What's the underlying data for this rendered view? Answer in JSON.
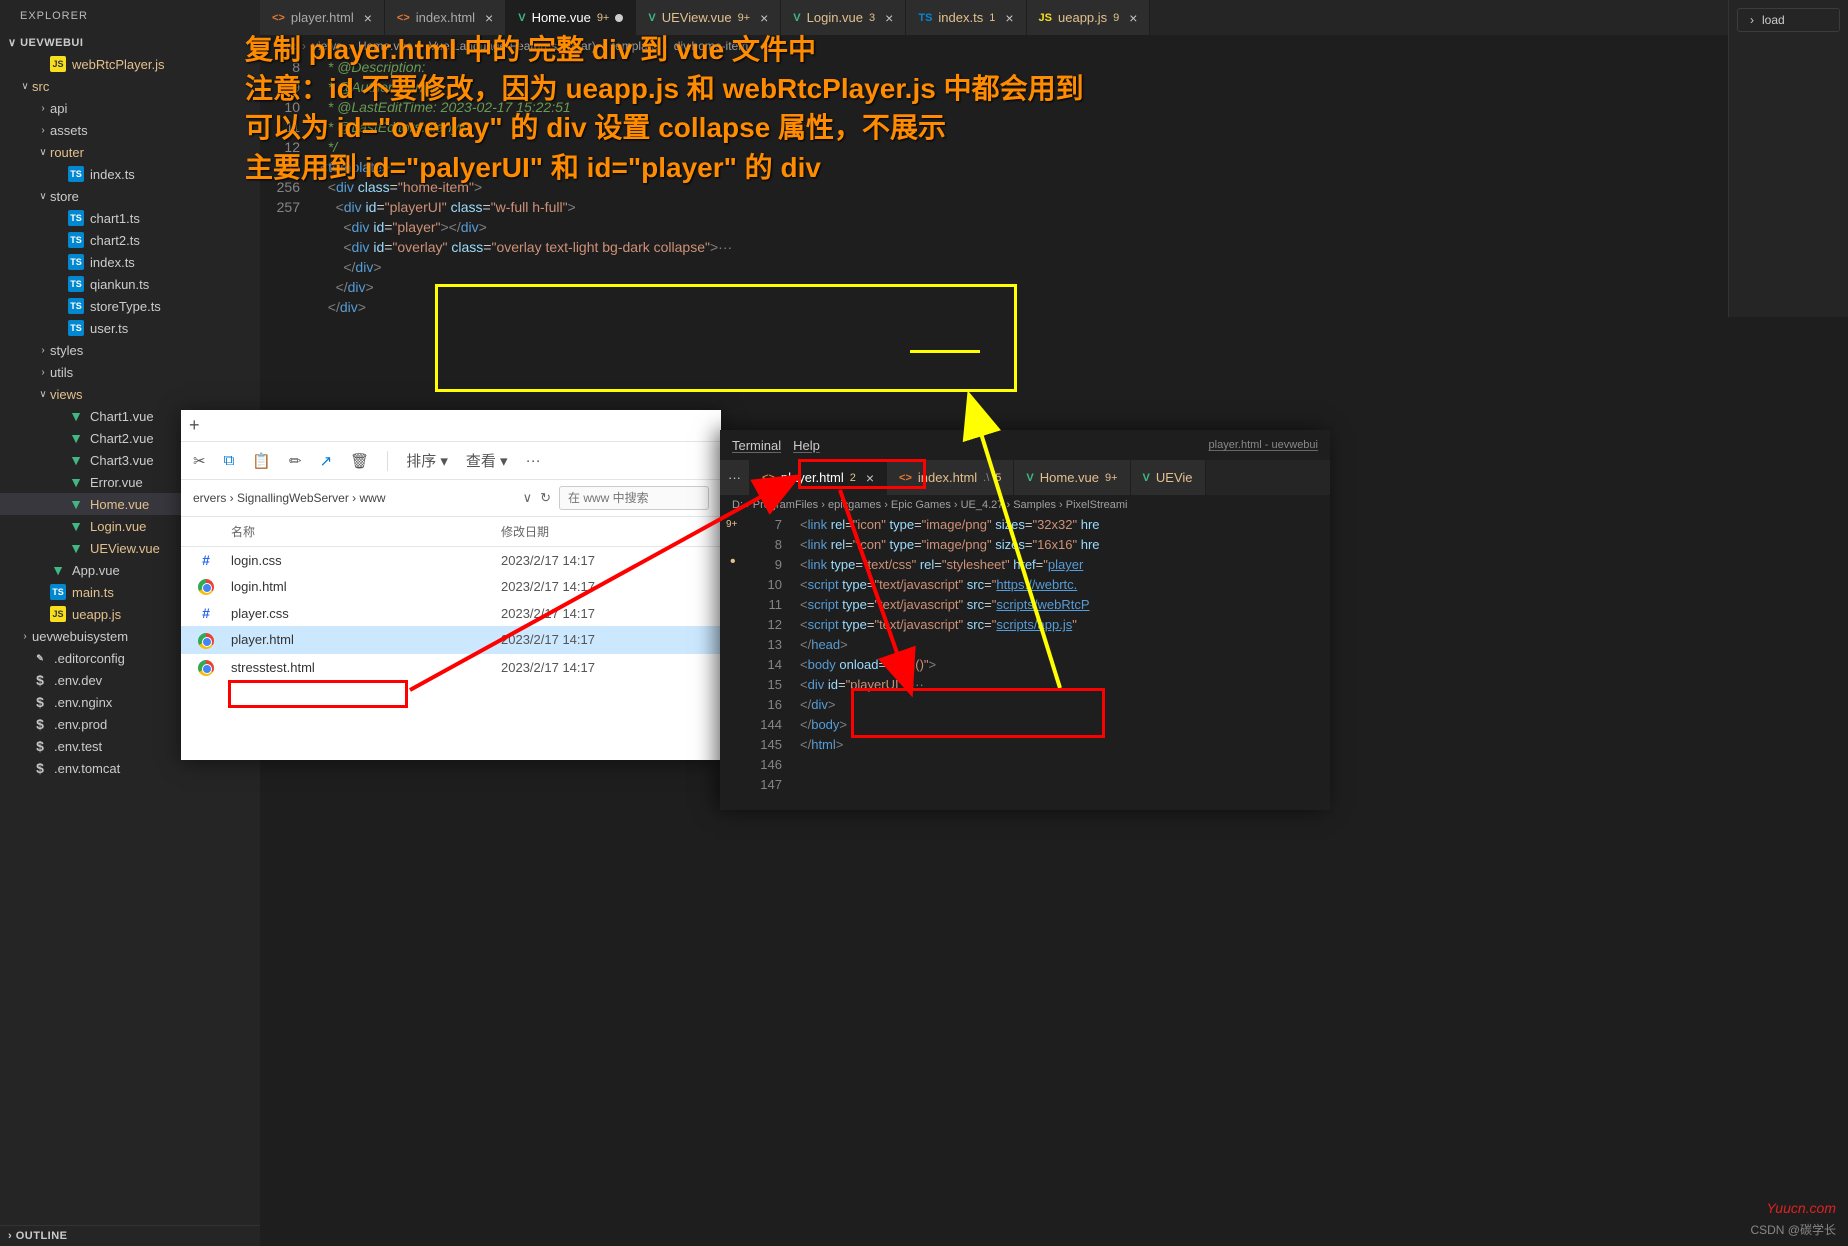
{
  "explorer": {
    "title": "EXPLORER",
    "root": "UEVWEBUI",
    "outline_section": "OUTLINE",
    "tree": [
      {
        "label": "webRtcPlayer.js",
        "indent": 36,
        "icon": "js",
        "cls": "lbl-y"
      },
      {
        "label": "src",
        "indent": 18,
        "chev": "∨",
        "cls": "lbl-y"
      },
      {
        "label": "api",
        "indent": 36,
        "chev": "›"
      },
      {
        "label": "assets",
        "indent": 36,
        "chev": "›"
      },
      {
        "label": "router",
        "indent": 36,
        "chev": "∨",
        "cls": "lbl-y"
      },
      {
        "label": "index.ts",
        "indent": 54,
        "icon": "ts"
      },
      {
        "label": "store",
        "indent": 36,
        "chev": "∨"
      },
      {
        "label": "chart1.ts",
        "indent": 54,
        "icon": "ts"
      },
      {
        "label": "chart2.ts",
        "indent": 54,
        "icon": "ts"
      },
      {
        "label": "index.ts",
        "indent": 54,
        "icon": "ts"
      },
      {
        "label": "qiankun.ts",
        "indent": 54,
        "icon": "ts"
      },
      {
        "label": "storeType.ts",
        "indent": 54,
        "icon": "ts"
      },
      {
        "label": "user.ts",
        "indent": 54,
        "icon": "ts"
      },
      {
        "label": "styles",
        "indent": 36,
        "chev": "›"
      },
      {
        "label": "utils",
        "indent": 36,
        "chev": "›"
      },
      {
        "label": "views",
        "indent": 36,
        "chev": "∨",
        "cls": "lbl-y"
      },
      {
        "label": "Chart1.vue",
        "indent": 54,
        "icon": "vue"
      },
      {
        "label": "Chart2.vue",
        "indent": 54,
        "icon": "vue"
      },
      {
        "label": "Chart3.vue",
        "indent": 54,
        "icon": "vue"
      },
      {
        "label": "Error.vue",
        "indent": 54,
        "icon": "vue"
      },
      {
        "label": "Home.vue",
        "indent": 54,
        "icon": "vue",
        "cls": "lbl-y",
        "active": true,
        "tag": "9+, M"
      },
      {
        "label": "Login.vue",
        "indent": 54,
        "icon": "vue",
        "cls": "lbl-y"
      },
      {
        "label": "UEView.vue",
        "indent": 54,
        "icon": "vue",
        "cls": "lbl-y"
      },
      {
        "label": "App.vue",
        "indent": 36,
        "icon": "vue"
      },
      {
        "label": "main.ts",
        "indent": 36,
        "icon": "ts",
        "cls": "lbl-y"
      },
      {
        "label": "ueapp.js",
        "indent": 36,
        "icon": "js",
        "cls": "lbl-y"
      },
      {
        "label": "uevwebuisystem",
        "indent": 18,
        "chev": "›"
      },
      {
        "label": ".editorconfig",
        "indent": 18,
        "icon": "file"
      },
      {
        "label": ".env.dev",
        "indent": 18,
        "icon": "dollar"
      },
      {
        "label": ".env.nginx",
        "indent": 18,
        "icon": "dollar"
      },
      {
        "label": ".env.prod",
        "indent": 18,
        "icon": "dollar"
      },
      {
        "label": ".env.test",
        "indent": 18,
        "icon": "dollar"
      },
      {
        "label": ".env.tomcat",
        "indent": 18,
        "icon": "dollar"
      }
    ]
  },
  "tabs": [
    {
      "label": "player.html",
      "icon": "<>",
      "iconColor": "#e37933"
    },
    {
      "label": "index.html",
      "icon": "<>",
      "iconColor": "#e37933"
    },
    {
      "label": "Home.vue",
      "icon": "V",
      "iconColor": "#41b883",
      "badge": "9+",
      "badgeColor": "#e2c08d",
      "active": true
    },
    {
      "label": "UEView.vue",
      "icon": "V",
      "iconColor": "#41b883",
      "badge": "9+",
      "badgeColor": "#e2c08d"
    },
    {
      "label": "Login.vue",
      "icon": "V",
      "iconColor": "#41b883",
      "badge": "3",
      "badgeColor": "#e2c08d"
    },
    {
      "label": "index.ts",
      "icon": "TS",
      "iconColor": "#0288d1",
      "badge": "1",
      "badgeColor": "#e2c08d"
    },
    {
      "label": "ueapp.js",
      "icon": "JS",
      "iconColor": "#f7df1e",
      "badge": "9",
      "badgeColor": "#e2c08d"
    }
  ],
  "breadcrumb": [
    "src",
    "views",
    "Home.vue",
    "Vue Language Features (Volar)",
    "template",
    "div.home-item"
  ],
  "right_panel_item": "load",
  "annotation": {
    "line1": "复制 player.html 中的 完整 div 到 vue 文件中",
    "line2": "注意：id 不要修改，因为 ueapp.js 和 webRtcPlayer.js 中都会用到",
    "line3": "可以为 id=\"overlay\" 的 div 设置 collapse 属性，不展示",
    "line4": "主要用到 id=\"palyerUI\" 和 id=\"player\" 的 div"
  },
  "code_main": {
    "line_numbers": [
      "7",
      "8",
      "9",
      "10",
      "11",
      "12",
      "255",
      "256",
      "257"
    ],
    "body": [
      {
        "raw": "  <span class='comment'>* @Description:</span>"
      },
      {
        "raw": "  <span class='comment'>* @Author: tianyw</span>"
      },
      {
        "raw": "  <span class='comment'>* @LastEditTime: 2023-02-17 15:22:51</span>"
      },
      {
        "raw": "  <span class='comment'>* @LastEditors: tianyw</span>"
      },
      {
        "raw": "  <span class='comment'>*/</span>"
      },
      {
        "raw": "<span class='tag'>&lt;</span><span class='tagname'>template</span><span class='tag'>&gt;</span>"
      },
      {
        "raw": "  <span class='tag'>&lt;</span><span class='tagname'>div</span> <span class='attr'>class</span>=<span class='val'>\"home-item\"</span><span class='tag'>&gt;</span>"
      },
      {
        "raw": "    <span class='tag'>&lt;</span><span class='tagname'>div</span> <span class='attr'>id</span>=<span class='val'>\"playerUI\"</span> <span class='attr'>class</span>=<span class='val'>\"w-full h-full\"</span><span class='tag'>&gt;</span>"
      },
      {
        "raw": "      <span class='tag'>&lt;</span><span class='tagname'>div</span> <span class='attr'>id</span>=<span class='val'>\"player\"</span><span class='tag'>&gt;&lt;/</span><span class='tagname'>div</span><span class='tag'>&gt;</span>"
      },
      {
        "raw": "      <span class='tag'>&lt;</span><span class='tagname'>div</span> <span class='attr'>id</span>=<span class='val'>\"overlay\"</span> <span class='attr'>class</span>=<span class='val'>\"overlay text-light bg-dark collapse\"</span><span class='tag'>&gt;</span><span style='color:#808080'>&middot;&middot;&middot;</span>"
      },
      {
        "raw": "      <span class='tag'>&lt;/</span><span class='tagname'>div</span><span class='tag'>&gt;</span>"
      },
      {
        "raw": "    <span class='tag'>&lt;/</span><span class='tagname'>div</span><span class='tag'>&gt;</span>"
      },
      {
        "raw": "  <span class='tag'>&lt;/</span><span class='tagname'>div</span><span class='tag'>&gt;</span>"
      }
    ]
  },
  "file_explorer": {
    "newtab": "+",
    "toolbar": {
      "sort": "排序 ▾",
      "view": "查看 ▾"
    },
    "path": "ervers › SignallingWebServer › www",
    "search_placeholder": "在 www 中搜索",
    "hdr_name": "名称",
    "hdr_date": "修改日期",
    "files": [
      {
        "name": "login.css",
        "date": "2023/2/17 14:17",
        "type": "css"
      },
      {
        "name": "login.html",
        "date": "2023/2/17 14:17",
        "type": "chrome"
      },
      {
        "name": "player.css",
        "date": "2023/2/17 14:17",
        "type": "css"
      },
      {
        "name": "player.html",
        "date": "2023/2/17 14:17",
        "type": "chrome",
        "selected": true
      },
      {
        "name": "stresstest.html",
        "date": "2023/2/17 14:17",
        "type": "chrome"
      }
    ]
  },
  "editor2": {
    "menu": {
      "terminal": "Terminal",
      "help": "Help"
    },
    "title_right": "player.html - uevwebui",
    "tabs": [
      {
        "label": "player.html",
        "icon": "<>",
        "iconColor": "#e37933",
        "badge": "2",
        "active": true,
        "close": "×"
      },
      {
        "label": "index.html",
        "icon": "<>",
        "iconColor": "#e37933",
        "extra": ".\\",
        "badge": "5"
      },
      {
        "label": "Home.vue",
        "icon": "V",
        "iconColor": "#41b883",
        "badge": "9+"
      },
      {
        "label": "UEVie",
        "icon": "V",
        "iconColor": "#41b883"
      }
    ],
    "breadcrumb": "D: › ProgramFiles › epicgames › Epic Games › UE_4.27 › Samples › PixelStreami",
    "line_numbers": [
      "7",
      "8",
      "9",
      "10",
      "11",
      "12",
      "13",
      "14",
      "15",
      "16",
      "144",
      "145",
      "146",
      "147"
    ],
    "gutter_badges": {
      "0": "9+",
      "2": "•"
    },
    "body": [
      {
        "raw": "    <span class='tag'>&lt;</span><span class='tagname'>link</span> <span class='attr'>rel</span>=<span class='val'>\"icon\"</span> <span class='attr'>type</span>=<span class='val'>\"image/png\"</span> <span class='attr'>sizes</span>=<span class='val'>\"32x32\"</span> <span class='attr'>hre</span>"
      },
      {
        "raw": "    <span class='tag'>&lt;</span><span class='tagname'>link</span> <span class='attr'>rel</span>=<span class='val'>\"icon\"</span> <span class='attr'>type</span>=<span class='val'>\"image/png\"</span> <span class='attr'>sizes</span>=<span class='val'>\"16x16\"</span> <span class='attr'>hre</span>"
      },
      {
        "raw": "    <span class='tag'>&lt;</span><span class='tagname'>link</span> <span class='attr'>type</span>=<span class='val'>\"text/css\"</span> <span class='attr'>rel</span>=<span class='val'>\"stylesheet\"</span> <span class='attr'>href</span>=<span class='val'>\"<span class='url-link'>player</span></span>"
      },
      {
        "raw": "    <span class='tag'>&lt;</span><span class='tagname'>script</span> <span class='attr'>type</span>=<span class='val'>\"text/javascript\"</span> <span class='attr'>src</span>=<span class='val'>\"<span class='url-link'>https://webrtc.</span></span>"
      },
      {
        "raw": "    <span class='tag'>&lt;</span><span class='tagname'>script</span> <span class='attr'>type</span>=<span class='val'>\"text/javascript\"</span> <span class='attr'>src</span>=<span class='val'>\"<span class='url-link'>scripts/webRtcP</span></span>"
      },
      {
        "raw": "    <span class='tag'>&lt;</span><span class='tagname'>script</span> <span class='attr'>type</span>=<span class='val'>\"text/javascript\"</span> <span class='attr'>src</span>=<span class='val'>\"<span class='url-link'>scripts/app.js</span>\"</span>"
      },
      {
        "raw": "<span class='tag'>&lt;/</span><span class='tagname'>head</span><span class='tag'>&gt;</span>"
      },
      {
        "raw": ""
      },
      {
        "raw": "<span class='tag'>&lt;</span><span class='tagname'>body</span> <span class='attr'>onload</span>=<span class='val'>\"load()\"</span><span class='tag'>&gt;</span>"
      },
      {
        "raw": "    <span class='tag'>&lt;</span><span class='tagname'>div</span> <span class='attr'>id</span>=<span class='val'>\"playerUI\"</span><span class='tag'>&gt;</span><span style='color:#808080'>&middot;&middot;&middot;</span>"
      },
      {
        "raw": "    <span class='tag'>&lt;/</span><span class='tagname'>div</span><span class='tag'>&gt;</span>"
      },
      {
        "raw": "<span class='tag'>&lt;/</span><span class='tagname'>body</span><span class='tag'>&gt;</span>"
      },
      {
        "raw": "<span class='tag'>&lt;/</span><span class='tagname'>html</span><span class='tag'>&gt;</span>"
      },
      {
        "raw": ""
      }
    ]
  },
  "watermark": "CSDN @碳学长",
  "watermark2": "Yuucn.com"
}
